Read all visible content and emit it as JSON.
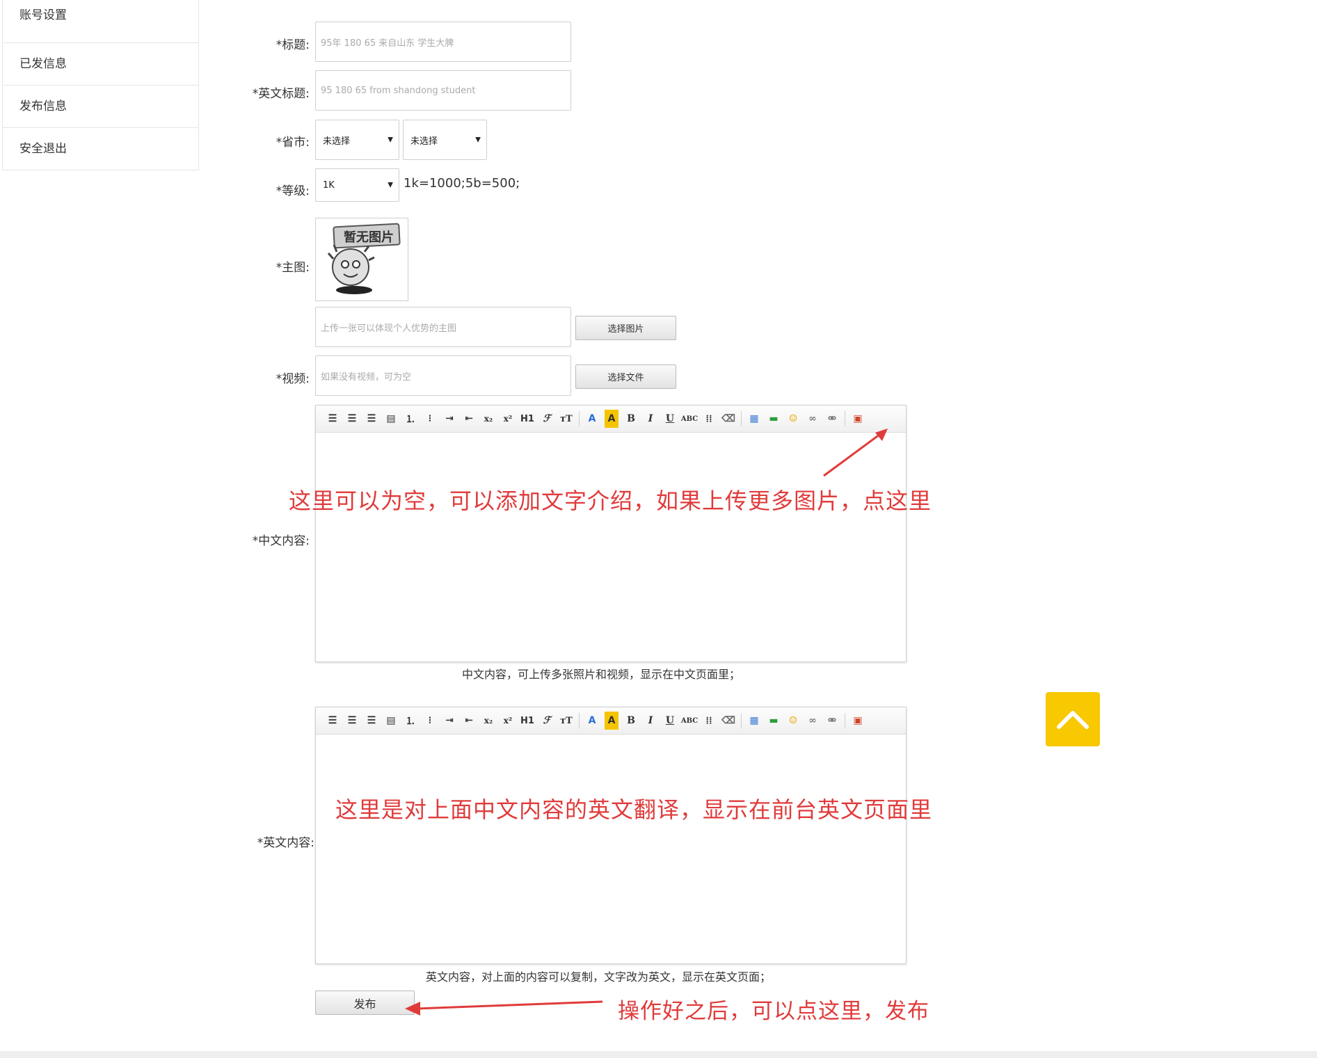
{
  "sidebar": {
    "items": [
      {
        "label": "账号设置"
      },
      {
        "label": "已发信息"
      },
      {
        "label": "发布信息"
      },
      {
        "label": "安全退出"
      }
    ]
  },
  "form": {
    "title": {
      "label": "*标题:",
      "placeholder": "95年 180 65 来自山东 学生大脾"
    },
    "en_title": {
      "label": "*英文标题:",
      "placeholder": "95 180 65 from shandong student"
    },
    "province": {
      "label": "*省市:",
      "province_value": "未选择",
      "city_value": "未选择"
    },
    "level": {
      "label": "*等级:",
      "value": "1K",
      "hint": "1k=1000;5b=500;"
    },
    "main_image": {
      "label": "*主图:",
      "placeholder_text": "暂无图片",
      "upload_placeholder": "上传一张可以体现个人优势的主图",
      "button": "选择图片"
    },
    "video": {
      "label": "*视频:",
      "placeholder": "如果没有视频，可为空",
      "button": "选择文件"
    },
    "cn_content": {
      "label": "*中文内容:",
      "caption": "中文内容，可上传多张照片和视频，显示在中文页面里；"
    },
    "en_content": {
      "label": "*英文内容:",
      "caption": "英文内容，对上面的内容可以复制，文字改为英文，显示在英文页面；"
    },
    "submit": {
      "label": "发布"
    }
  },
  "annotations": {
    "cn_editor_note": "这里可以为空，可以添加文字介绍，如果上传更多图片，点这里",
    "en_editor_note": "这里是对上面中文内容的英文翻译，显示在前台英文页面里",
    "submit_note": "操作好之后，可以点这里，发布"
  },
  "colors": {
    "annotation_red": "#e03b3b",
    "to_top_bg": "#f8c800"
  },
  "icons": [
    "align-left-icon",
    "align-center-icon",
    "align-right-icon",
    "justify-icon",
    "ordered-list-icon",
    "unordered-list-icon",
    "indent-icon",
    "outdent-icon",
    "subscript-icon",
    "superscript-icon",
    "heading-icon",
    "font-family-icon",
    "font-size-icon",
    "font-color-icon",
    "background-color-icon",
    "bold-icon",
    "italic-icon",
    "underline-icon",
    "strikethrough-icon",
    "hr-icon",
    "eraser-icon",
    "table-icon",
    "insert-image-icon",
    "emoji-icon",
    "link-icon",
    "unlink-icon",
    "multi-image-upload-icon",
    "chevron-up-icon"
  ]
}
